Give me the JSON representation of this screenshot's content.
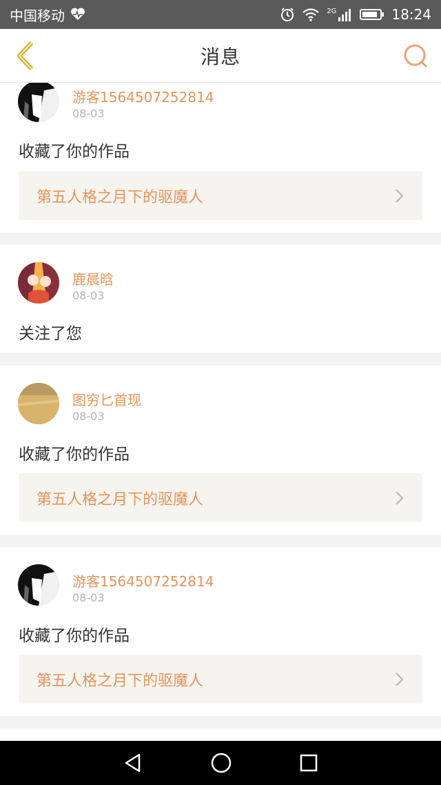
{
  "status_bar": {
    "carrier": "中国移动",
    "network": "2G",
    "time": "18:24"
  },
  "header": {
    "title": "消息"
  },
  "colors": {
    "accent": "#e6945c",
    "back_arrow": "#d9a51c",
    "card_link_bg": "#f5f4ef"
  },
  "notifications": [
    {
      "username": "游客1564507252814",
      "date": "08-03",
      "action": "收藏了你的作品",
      "work_title": "第五人格之月下的驱魔人"
    },
    {
      "username": "鹿晨晗",
      "date": "08-03",
      "action": "关注了您"
    },
    {
      "username": "图穷匕首现",
      "date": "08-03",
      "action": "收藏了你的作品",
      "work_title": "第五人格之月下的驱魔人"
    },
    {
      "username": "游客1564507252814",
      "date": "08-03",
      "action": "收藏了你的作品",
      "work_title": "第五人格之月下的驱魔人"
    }
  ]
}
